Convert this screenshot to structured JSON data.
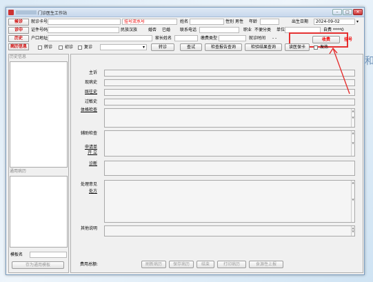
{
  "window": {
    "title": "门诊医生工作站",
    "min": "–",
    "max": "□",
    "close": "✕"
  },
  "left_buttons": [
    "候诊",
    "诊中",
    "历史",
    "病历信息"
  ],
  "row1": {
    "card_label": "就诊卡号",
    "reg_no": "挂号流水号",
    "name_label": "姓名",
    "gender_label": "性别",
    "gender_value": "男性",
    "age_label": "年龄",
    "dob_label": "出生日期",
    "dob_value": "2024-09-02"
  },
  "row2": {
    "id_label": "证件号码",
    "ethnic_label": "民族",
    "ethnic_value": "汉族",
    "marital_label": "婚否",
    "marital_value": "已婚",
    "phone_label": "联系电话",
    "job_label": "职业",
    "category_value": "不便分类",
    "unit_label": "单位",
    "self_pay_label": "自费 ****0",
    "charge_btn": "收费",
    "register_btn": "挂号"
  },
  "row3": {
    "address_label": "户口地址",
    "guardian_label": "家长姓名",
    "fee_type_label": "缴费类型",
    "visit_time_label": "就诊时间",
    "visit_time_value": "-  -"
  },
  "row4": {
    "transfer_label": "转诊",
    "first_visit_label": "初诊",
    "revisit_label": "复诊",
    "transfer_btn": "转诊",
    "tests_btn": "查试",
    "exam_report_btn": "检查报告查询",
    "lab_result_btn": "检验结果查询",
    "card_btn": "读医保卡",
    "fever_label": "发热"
  },
  "left_panel": {
    "history_title": "历史信息",
    "template_title": "通用病历",
    "template_name_label": "模板名",
    "save_template_btn": "存为通用模板"
  },
  "form_labels": [
    "主诉",
    "现病史",
    "既往史",
    "过敏史",
    "体格检查",
    "辅助检查",
    "申请单",
    "开  立",
    "诊断",
    "处理意见",
    "处方",
    "其他说明"
  ],
  "footer": {
    "total_label": "费用总额:",
    "buttons": [
      "刷新病历",
      "保存病历",
      "结束",
      "打印病历",
      "食源性上报"
    ]
  },
  "annotation_char": "和",
  "colors": {
    "highlight": "#e53030",
    "red_text": "#e00000"
  }
}
